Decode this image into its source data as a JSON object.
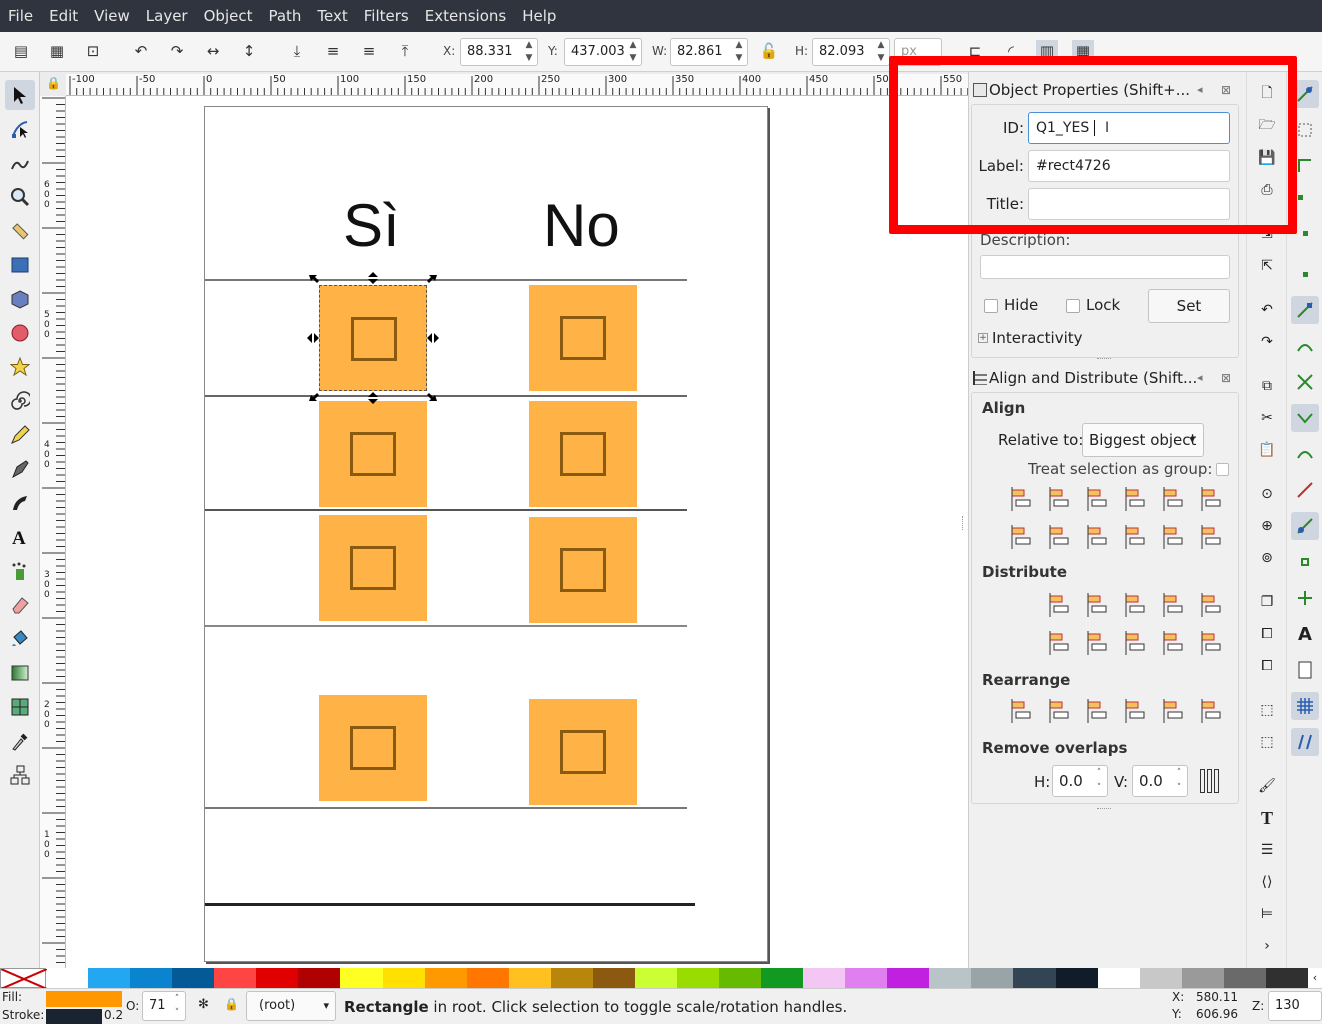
{
  "menubar": {
    "items": [
      "File",
      "Edit",
      "View",
      "Layer",
      "Object",
      "Path",
      "Text",
      "Filters",
      "Extensions",
      "Help"
    ]
  },
  "toolbar": {
    "x_label": "X:",
    "x_value": "88.331",
    "y_label": "Y:",
    "y_value": "437.003",
    "w_label": "W:",
    "w_value": "82.861",
    "h_label": "H:",
    "h_value": "82.093",
    "unit_value": "px"
  },
  "ruler": {
    "h_ticks": [
      "-100",
      "-50",
      "0",
      "50",
      "100",
      "150",
      "200",
      "250",
      "300",
      "350",
      "400",
      "450",
      "500",
      "550"
    ],
    "v_ticks": [
      "600",
      "500",
      "400",
      "300",
      "200",
      "100"
    ]
  },
  "canvas": {
    "col_si": "Sì",
    "col_no": "No"
  },
  "object_properties": {
    "title": "Object Properties (Shift+...",
    "id_label": "ID:",
    "id_value": "Q1_YES",
    "label_label": "Label:",
    "label_value": "#rect4726",
    "title_label": "Title:",
    "title_value": "",
    "description_label": "Description:",
    "hide_label": "Hide",
    "lock_label": "Lock",
    "set_label": "Set",
    "interactivity_label": "Interactivity"
  },
  "align_distribute": {
    "title": "Align and Distribute (Shift...",
    "align_heading": "Align",
    "relative_label": "Relative to:",
    "relative_value": "Biggest object",
    "treat_group_label": "Treat selection as group:",
    "distribute_heading": "Distribute",
    "rearrange_heading": "Rearrange",
    "remove_overlaps_heading": "Remove overlaps",
    "h_label": "H:",
    "h_value": "0.0",
    "v_label": "V:",
    "v_value": "0.0"
  },
  "colors": {
    "accent_highlight": "#ff0000",
    "fill_orange": "#ffb347",
    "selected_fill": "#ff9800",
    "stroke_dark": "#1a2430"
  },
  "palette": [
    "#ffffff",
    "#22a7f0",
    "#0b84d0",
    "#045a96",
    "#ff4444",
    "#e00000",
    "#b00000",
    "#ffff22",
    "#ffe000",
    "#ff9900",
    "#ff7700",
    "#ffc020",
    "#b8860b",
    "#8b5a10",
    "#ccff33",
    "#99dd00",
    "#66bb00",
    "#119922",
    "#f4c6f4",
    "#e080f0",
    "#c020e0",
    "#b8c4c8",
    "#98a4a8",
    "#334455",
    "#101d28",
    "#ffffff",
    "#c8c8c8",
    "#9a9a9a",
    "#6a6a6a",
    "#303030"
  ],
  "status": {
    "fill_label": "Fill:",
    "stroke_label": "Stroke:",
    "stroke_width": "0.2",
    "opacity_label": "O:",
    "opacity_value": "71",
    "layer_value": "(root)",
    "message_bold": "Rectangle",
    "message_rest": " in root. Click selection to toggle scale/rotation handles.",
    "cursor_x_label": "X:",
    "cursor_x": "580.11",
    "cursor_y_label": "Y:",
    "cursor_y": "606.96",
    "zoom_label": "Z:",
    "zoom_value": "130"
  }
}
